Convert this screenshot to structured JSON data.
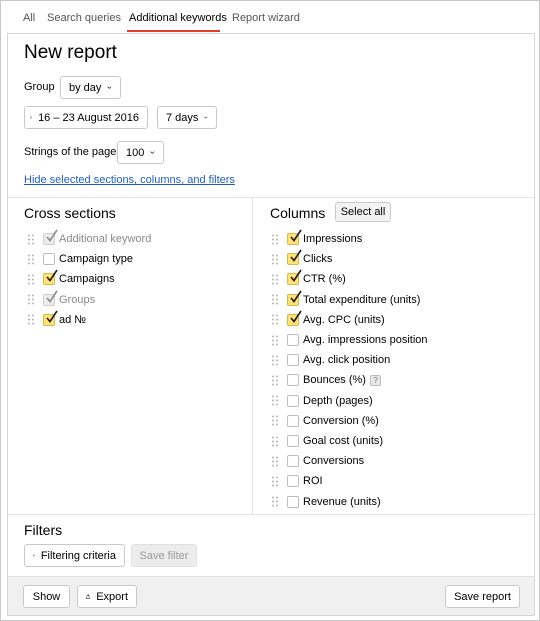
{
  "tabs": [
    {
      "label": "All"
    },
    {
      "label": "Search queries"
    },
    {
      "label": "Additional keywords"
    },
    {
      "label": "Report wizard"
    }
  ],
  "report": {
    "title": "New report",
    "group_label": "Group",
    "group_value": "by day",
    "date_range": "16 – 23 August 2016",
    "period": "7 days",
    "strings_label": "Strings of the page",
    "strings_value": "100",
    "hide_link": "Hide selected sections, columns, and filters"
  },
  "cross_sections": {
    "title": "Cross sections",
    "items": [
      {
        "label": "Additional keyword",
        "checked": true,
        "muted": true
      },
      {
        "label": "Campaign type",
        "checked": false,
        "muted": false
      },
      {
        "label": "Campaigns",
        "checked": true,
        "muted": false
      },
      {
        "label": "Groups",
        "checked": true,
        "muted": true
      },
      {
        "label": "ad №",
        "checked": true,
        "muted": false
      }
    ]
  },
  "columns": {
    "title": "Columns",
    "select_all": "Select all",
    "items": [
      {
        "label": "Impressions",
        "checked": true
      },
      {
        "label": "Clicks",
        "checked": true
      },
      {
        "label": "CTR (%)",
        "checked": true
      },
      {
        "label": "Total expenditure (units)",
        "checked": true
      },
      {
        "label": "Avg. CPC (units)",
        "checked": true
      },
      {
        "label": "Avg. impressions position",
        "checked": false
      },
      {
        "label": "Avg. click position",
        "checked": false
      },
      {
        "label": "Bounces (%)",
        "checked": false,
        "help": "?"
      },
      {
        "label": "Depth (pages)",
        "checked": false
      },
      {
        "label": "Conversion (%)",
        "checked": false
      },
      {
        "label": "Goal cost (units)",
        "checked": false
      },
      {
        "label": "Conversions",
        "checked": false
      },
      {
        "label": "ROI",
        "checked": false
      },
      {
        "label": "Revenue (units)",
        "checked": false
      }
    ]
  },
  "filters": {
    "title": "Filters",
    "add_label": "Filtering criteria",
    "save_label": "Save filter"
  },
  "footer": {
    "show_label": "Show",
    "export_label": "Export",
    "save_report_label": "Save report"
  },
  "colors": {
    "accent_underline": "#e53b2c",
    "link": "#1f5fbf",
    "checkbox_checked": "#ffe17a"
  }
}
